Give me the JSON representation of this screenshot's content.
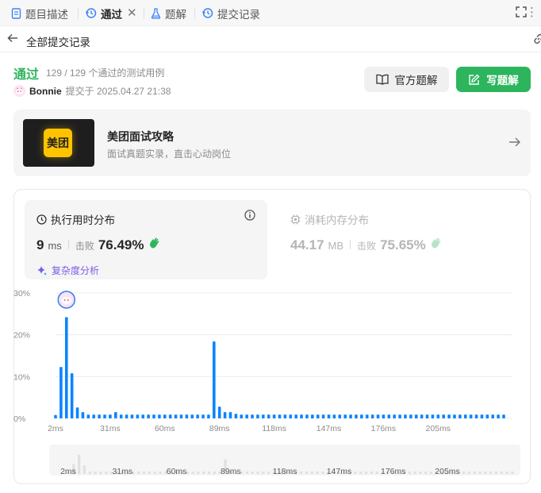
{
  "tabs": [
    {
      "label": "题目描述"
    },
    {
      "label": "通过"
    },
    {
      "label": "题解"
    },
    {
      "label": "提交记录"
    }
  ],
  "back_label": "全部提交记录",
  "result": {
    "status": "通过",
    "cases": "129 / 129 个通过的测试用例",
    "user": "Bonnie",
    "submitted_at": "提交于 2025.04.27 21:38"
  },
  "buttons": {
    "official": "官方题解",
    "write": "写题解"
  },
  "promo": {
    "logo_text": "美团",
    "title": "美团面试攻略",
    "subtitle": "面试真题实录，直击心动岗位"
  },
  "runtime": {
    "title": "执行用时分布",
    "value": "9",
    "unit": "ms",
    "beat_label": "击败",
    "beat": "76.49%",
    "complexity": "复杂度分析"
  },
  "memory": {
    "title": "消耗内存分布",
    "value": "44.17",
    "unit": "MB",
    "beat_label": "击败",
    "beat": "75.65%"
  },
  "colors": {
    "accent_green": "#2db55d",
    "bar_blue": "#0a84ff",
    "purple": "#7c5ce8"
  },
  "chart_data": {
    "type": "bar",
    "y_ticks": [
      "30%",
      "20%",
      "10%",
      "0%"
    ],
    "ylim": [
      0,
      30
    ],
    "x_ticks": [
      "2ms",
      "31ms",
      "60ms",
      "89ms",
      "118ms",
      "147ms",
      "176ms",
      "205ms"
    ],
    "x_start_ms": 2,
    "bin_width_ms": 2.9,
    "highlight_index": 2,
    "values": [
      0.8,
      12.3,
      24.2,
      10.8,
      2.6,
      1.5,
      0.9,
      0.9,
      0.9,
      0.9,
      0.9,
      1.5,
      0.9,
      0.9,
      0.9,
      0.9,
      0.9,
      0.9,
      0.9,
      0.9,
      0.9,
      0.9,
      0.9,
      0.9,
      0.9,
      0.9,
      0.9,
      0.9,
      0.9,
      18.4,
      2.8,
      1.5,
      1.5,
      1.1,
      0.9,
      0.9,
      0.9,
      0.9,
      0.9,
      0.9,
      0.9,
      0.9,
      0.9,
      0.9,
      0.9,
      0.9,
      0.9,
      0.9,
      0.9,
      0.9,
      0.9,
      0.9,
      0.9,
      0.9,
      0.9,
      0.9,
      0.9,
      0.9,
      0.9,
      0.9,
      0.9,
      0.9,
      0.9,
      0.9,
      0.9,
      0.9,
      0.9,
      0.9,
      0.9,
      0.9,
      0.9,
      0.9,
      0.9,
      0.9,
      0.9,
      0.9,
      0.9,
      0.9,
      0.9,
      0.9,
      0.9,
      0.9,
      0.9
    ]
  }
}
